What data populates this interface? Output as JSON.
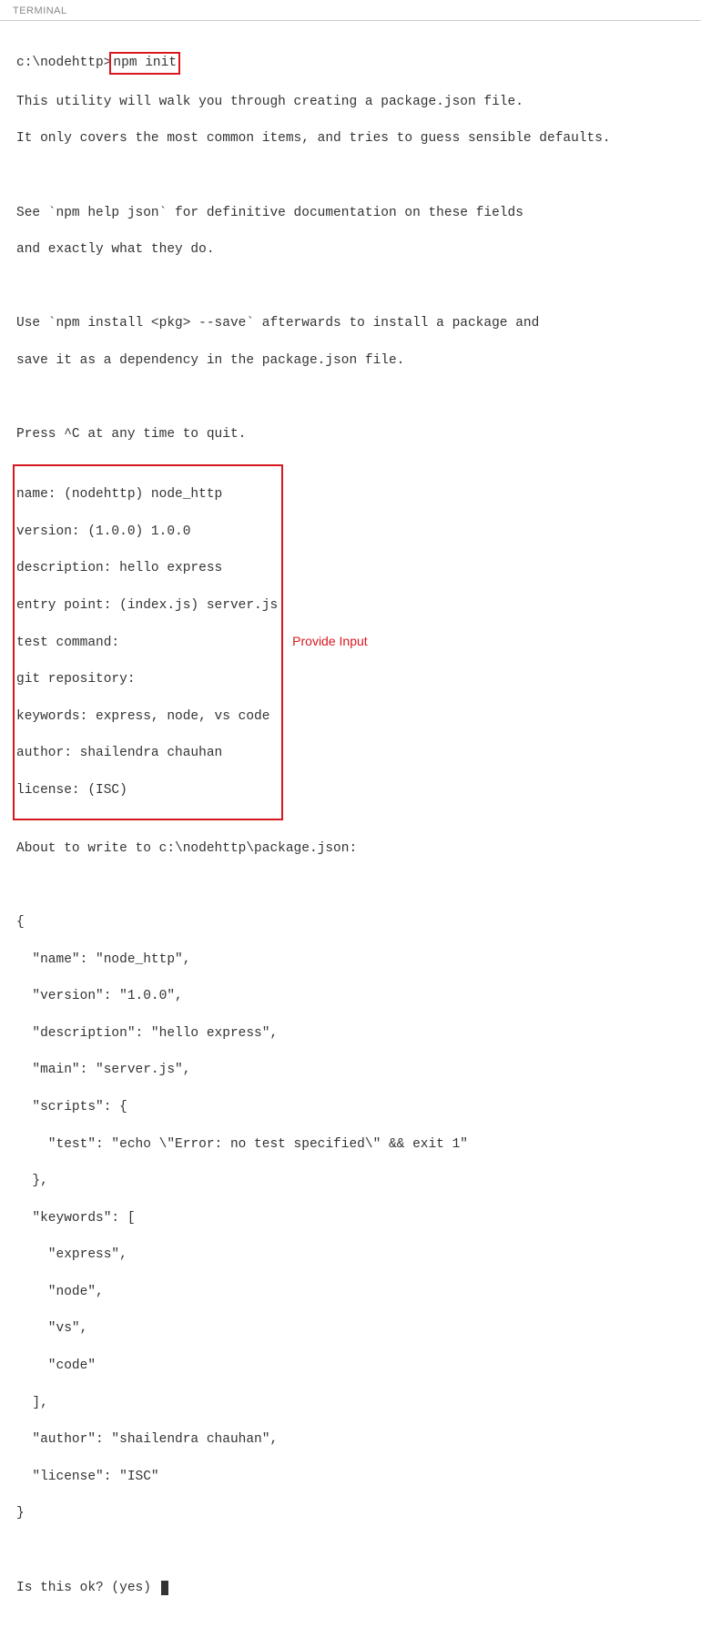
{
  "panel": {
    "title": "TERMINAL"
  },
  "prompt": {
    "path": "c:\\nodehttp>",
    "command": "npm init"
  },
  "intro": {
    "line1": "This utility will walk you through creating a package.json file.",
    "line2": "It only covers the most common items, and tries to guess sensible defaults.",
    "line3": "See `npm help json` for definitive documentation on these fields",
    "line4": "and exactly what they do.",
    "line5": "Use `npm install <pkg> --save` afterwards to install a package and",
    "line6": "save it as a dependency in the package.json file.",
    "line7": "Press ^C at any time to quit."
  },
  "inputs": {
    "l1": "name: (nodehttp) node_http",
    "l2": "version: (1.0.0) 1.0.0",
    "l3": "description: hello express",
    "l4": "entry point: (index.js) server.js",
    "l5": "test command:",
    "l6": "git repository:",
    "l7": "keywords: express, node, vs code",
    "l8": "author: shailendra chauhan",
    "l9": "license: (ISC)"
  },
  "annotation": "Provide Input",
  "about": "About to write to c:\\nodehttp\\package.json:",
  "pkg": {
    "open": "{",
    "name": "  \"name\": \"node_http\",",
    "version": "  \"version\": \"1.0.0\",",
    "description": "  \"description\": \"hello express\",",
    "main": "  \"main\": \"server.js\",",
    "scripts_open": "  \"scripts\": {",
    "test": "    \"test\": \"echo \\\"Error: no test specified\\\" && exit 1\"",
    "scripts_close": "  },",
    "keywords_open": "  \"keywords\": [",
    "kw1": "    \"express\",",
    "kw2": "    \"node\",",
    "kw3": "    \"vs\",",
    "kw4": "    \"code\"",
    "keywords_close": "  ],",
    "author": "  \"author\": \"shailendra chauhan\",",
    "license": "  \"license\": \"ISC\"",
    "close": "}"
  },
  "confirm": "Is this ok? (yes) "
}
